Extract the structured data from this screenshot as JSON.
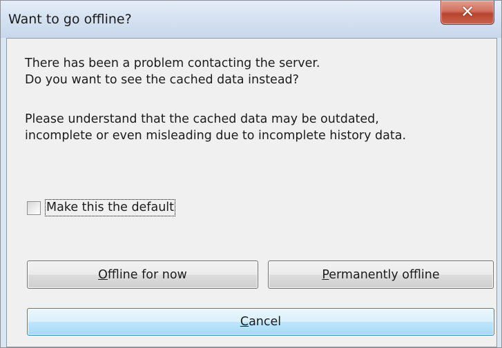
{
  "window": {
    "title": "Want to go offline?",
    "close_icon": "close-icon"
  },
  "message": {
    "line1": "There has been a problem contacting the server.",
    "line2": "Do you want to see the cached data instead?",
    "line3": "Please understand that the cached data may be outdated,",
    "line4": "incomplete or even misleading due to incomplete history data."
  },
  "checkbox": {
    "label": "Make this the default",
    "checked": false
  },
  "buttons": {
    "offline_now": {
      "mnemonic": "O",
      "rest": "ffline for now"
    },
    "permanently_offline": {
      "mnemonic": "P",
      "rest": "ermanently offline"
    },
    "cancel": {
      "mnemonic": "C",
      "rest": "ancel"
    }
  },
  "colors": {
    "client_bg": "#f0f0f0",
    "cancel_accent": "#3c7fb1",
    "close_red": "#c9624d"
  }
}
